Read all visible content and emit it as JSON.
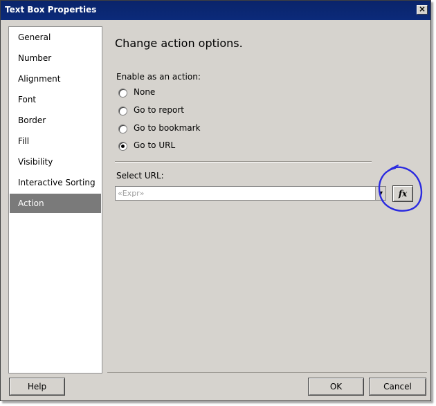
{
  "window": {
    "title": "Text Box Properties",
    "close_label": "×"
  },
  "sidebar": {
    "items": [
      {
        "label": "General"
      },
      {
        "label": "Number"
      },
      {
        "label": "Alignment"
      },
      {
        "label": "Font"
      },
      {
        "label": "Border"
      },
      {
        "label": "Fill"
      },
      {
        "label": "Visibility"
      },
      {
        "label": "Interactive Sorting"
      },
      {
        "label": "Action"
      }
    ],
    "selected": "Action"
  },
  "main": {
    "heading": "Change action options.",
    "enable_label": "Enable as an action:",
    "options": [
      {
        "label": "None",
        "checked": false
      },
      {
        "label": "Go to report",
        "checked": false
      },
      {
        "label": "Go to bookmark",
        "checked": false
      },
      {
        "label": "Go to URL",
        "checked": true
      }
    ],
    "url_label": "Select URL:",
    "url_placeholder": "«Expr»",
    "url_value": "",
    "fx_label": "fx"
  },
  "footer": {
    "help_label": "Help",
    "ok_label": "OK",
    "cancel_label": "Cancel"
  },
  "colors": {
    "titlebar": "#0a246a",
    "annotation": "#2a2ae0",
    "selected_item": "#7a7a7a"
  }
}
